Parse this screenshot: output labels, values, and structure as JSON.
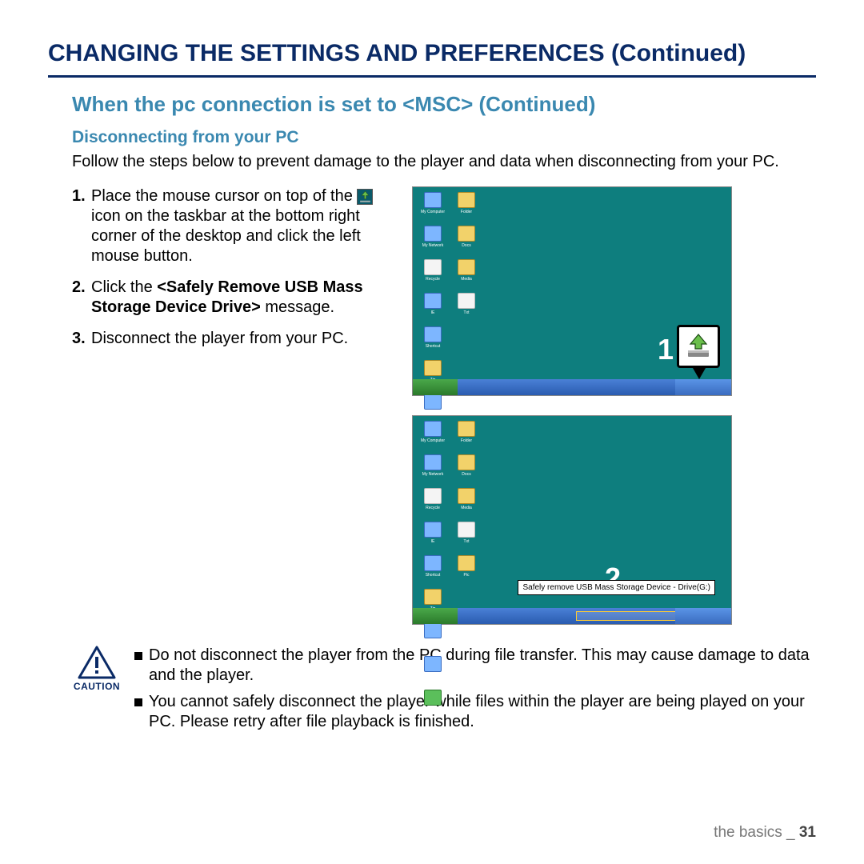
{
  "title": "CHANGING THE SETTINGS AND PREFERENCES (Continued)",
  "subtitle": "When the pc connection is set to <MSC> (Continued)",
  "section_header": "Disconnecting from your PC",
  "intro": "Follow the steps below to prevent damage to the player and data when disconnecting from your PC.",
  "steps": {
    "s1_num": "1.",
    "s1_a": "Place the mouse cursor on top of the ",
    "s1_b": " icon on the taskbar at the bottom right corner of the desktop and click the left mouse button.",
    "s2_num": "2.",
    "s2_a": "Click the ",
    "s2_bold": "<Safely Remove USB Mass Storage Device Drive>",
    "s2_b": " message.",
    "s3_num": "3.",
    "s3": "Disconnect the player from your PC."
  },
  "screenshots": {
    "badge1": "1",
    "badge2": "2",
    "tooltip": "Safely remove USB Mass Storage Device - Drive(G:)"
  },
  "caution": {
    "label": "CAUTION",
    "b1": "Do not disconnect the player from the PC during file transfer. This may cause damage to data and the player.",
    "b2": "You cannot safely disconnect the player while files within the player are being played on your PC. Please retry after file playback is finished."
  },
  "footer": {
    "section": "the basics _",
    "page": "31"
  }
}
